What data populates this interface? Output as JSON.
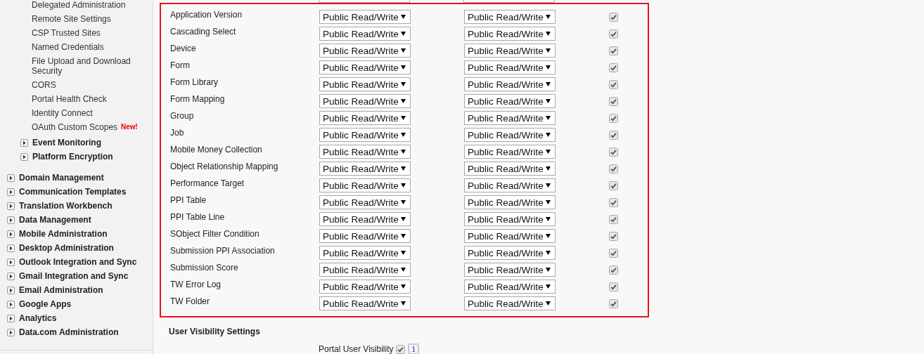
{
  "sidebar": {
    "sub_items": [
      {
        "kind": "link",
        "label": "Delegated Administration"
      },
      {
        "kind": "link",
        "label": "Remote Site Settings"
      },
      {
        "kind": "link",
        "label": "CSP Trusted Sites"
      },
      {
        "kind": "link",
        "label": "Named Credentials"
      },
      {
        "kind": "link",
        "label": "File Upload and Download Security"
      },
      {
        "kind": "link",
        "label": "CORS"
      },
      {
        "kind": "link",
        "label": "Portal Health Check"
      },
      {
        "kind": "link",
        "label": "Identity Connect"
      },
      {
        "kind": "link",
        "label": "OAuth Custom Scopes",
        "badge": "New!"
      },
      {
        "kind": "group",
        "label": "Event Monitoring",
        "expanded": false
      },
      {
        "kind": "group",
        "label": "Platform Encryption",
        "expanded": false
      }
    ],
    "items": [
      {
        "label": "Domain Management",
        "expanded": false
      },
      {
        "label": "Communication Templates",
        "expanded": false
      },
      {
        "label": "Translation Workbench",
        "expanded": false
      },
      {
        "label": "Data Management",
        "expanded": false
      },
      {
        "label": "Mobile Administration",
        "expanded": false
      },
      {
        "label": "Desktop Administration",
        "expanded": false
      },
      {
        "label": "Outlook Integration and Sync",
        "expanded": false
      },
      {
        "label": "Gmail Integration and Sync",
        "expanded": false
      },
      {
        "label": "Email Administration",
        "expanded": false
      },
      {
        "label": "Google Apps",
        "expanded": false
      },
      {
        "label": "Analytics",
        "expanded": false
      },
      {
        "label": "Data.com Administration",
        "expanded": false
      }
    ]
  },
  "sharing_rows": [
    {
      "object": "Application Version",
      "internal_access": "Public Read/Write",
      "external_access": "Public Read/Write",
      "grant_access": true
    },
    {
      "object": "Cascading Select",
      "internal_access": "Public Read/Write",
      "external_access": "Public Read/Write",
      "grant_access": true
    },
    {
      "object": "Device",
      "internal_access": "Public Read/Write",
      "external_access": "Public Read/Write",
      "grant_access": true
    },
    {
      "object": "Form",
      "internal_access": "Public Read/Write",
      "external_access": "Public Read/Write",
      "grant_access": true
    },
    {
      "object": "Form Library",
      "internal_access": "Public Read/Write",
      "external_access": "Public Read/Write",
      "grant_access": true
    },
    {
      "object": "Form Mapping",
      "internal_access": "Public Read/Write",
      "external_access": "Public Read/Write",
      "grant_access": true
    },
    {
      "object": "Group",
      "internal_access": "Public Read/Write",
      "external_access": "Public Read/Write",
      "grant_access": true
    },
    {
      "object": "Job",
      "internal_access": "Public Read/Write",
      "external_access": "Public Read/Write",
      "grant_access": true
    },
    {
      "object": "Mobile Money Collection",
      "internal_access": "Public Read/Write",
      "external_access": "Public Read/Write",
      "grant_access": true
    },
    {
      "object": "Object Relationship Mapping",
      "internal_access": "Public Read/Write",
      "external_access": "Public Read/Write",
      "grant_access": true
    },
    {
      "object": "Performance Target",
      "internal_access": "Public Read/Write",
      "external_access": "Public Read/Write",
      "grant_access": true
    },
    {
      "object": "PPI Table",
      "internal_access": "Public Read/Write",
      "external_access": "Public Read/Write",
      "grant_access": true
    },
    {
      "object": "PPI Table Line",
      "internal_access": "Public Read/Write",
      "external_access": "Public Read/Write",
      "grant_access": true
    },
    {
      "object": "SObject Filter Condition",
      "internal_access": "Public Read/Write",
      "external_access": "Public Read/Write",
      "grant_access": true
    },
    {
      "object": "Submission PPI Association",
      "internal_access": "Public Read/Write",
      "external_access": "Public Read/Write",
      "grant_access": true
    },
    {
      "object": "Submission Score",
      "internal_access": "Public Read/Write",
      "external_access": "Public Read/Write",
      "grant_access": true
    },
    {
      "object": "TW Error Log",
      "internal_access": "Public Read/Write",
      "external_access": "Public Read/Write",
      "grant_access": true
    },
    {
      "object": "TW Folder",
      "internal_access": "Public Read/Write",
      "external_access": "Public Read/Write",
      "grant_access": true
    }
  ],
  "user_visibility": {
    "heading": "User Visibility Settings",
    "label": "Portal User Visibility",
    "checked": true
  }
}
